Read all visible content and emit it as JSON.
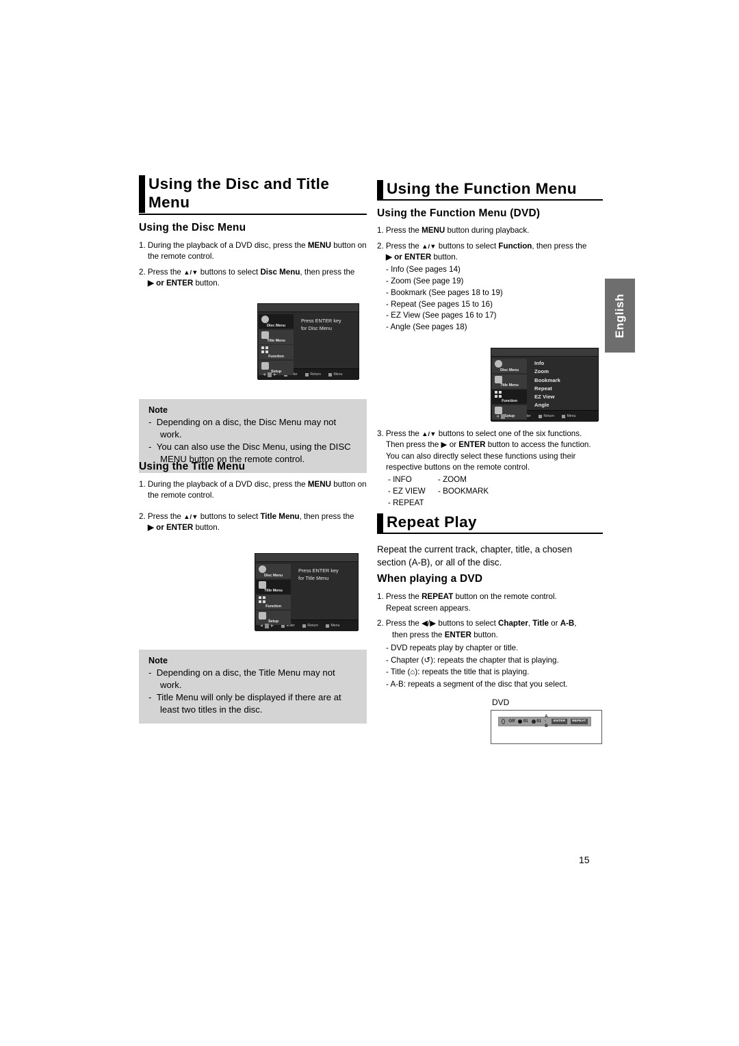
{
  "page": {
    "number": "15",
    "side_tab": "English"
  },
  "left_column": {
    "heading": "Using the Disc and Title Menu",
    "disc_menu": {
      "subheading": "Using the Disc Menu",
      "steps": [
        {
          "num": "1.",
          "parts": [
            "During the playback of a DVD disc, press the ",
            "MENU",
            " button on the remote control."
          ]
        },
        {
          "num": "2.",
          "parts": [
            "Press the ",
            "▲/▼",
            " buttons to select ",
            "Disc Menu",
            ", then press the ",
            "▶ or ENTER",
            " button."
          ]
        }
      ],
      "screen": {
        "sidebar": [
          "Disc Menu",
          "Title Menu",
          "Function",
          "Setup"
        ],
        "selected": "Disc Menu",
        "content_lines": [
          "Press ENTER key",
          "for Disc Menu"
        ],
        "bottom_keys": [
          "Enter",
          "Return",
          "Menu"
        ]
      },
      "note": {
        "title": "Note",
        "items": [
          "Depending on a disc, the Disc Menu may not work.",
          "You can also use the Disc Menu, using the DISC MENU button on the remote control."
        ]
      }
    },
    "title_menu": {
      "subheading": "Using the Title Menu",
      "steps": [
        {
          "num": "1.",
          "parts": [
            "During the playback of a DVD disc, press the ",
            "MENU",
            " button on the remote control."
          ]
        },
        {
          "num": "2.",
          "parts": [
            "Press the ",
            "▲/▼",
            " buttons to select ",
            "Title Menu",
            ", then press the ",
            "▶ or ENTER",
            " button."
          ]
        }
      ],
      "screen": {
        "sidebar": [
          "Disc Menu",
          "Title Menu",
          "Function",
          "Setup"
        ],
        "selected": "Title Menu",
        "content_lines": [
          "Press ENTER key",
          "for Title Menu"
        ],
        "bottom_keys": [
          "Enter",
          "Return",
          "Menu"
        ]
      },
      "note": {
        "title": "Note",
        "items": [
          "Depending on a disc, the Title Menu may not work.",
          "Title Menu will only be displayed if there are at least two titles in the disc."
        ]
      }
    }
  },
  "right_column": {
    "heading": "Using the Function Menu",
    "function_menu": {
      "subheading": "Using the Function Menu (DVD)",
      "step1_pre": "Press the ",
      "step1_bold": "MENU",
      "step1_post": " button during playback.",
      "step2_a": "Press the ",
      "step2_ud": "▲/▼",
      "step2_b": " buttons to select ",
      "step2_bold": "Function",
      "step2_c": ", then press the ",
      "step2_d": "▶ or ENTER",
      "step2_e": " button.",
      "function_list": [
        "- Info (See pages 14)",
        "- Zoom (See page 19)",
        "- Bookmark (See pages 18 to 19)",
        "- Repeat (See pages 15 to 16)",
        "- EZ View (See pages 16 to 17)",
        "- Angle (See pages 18)"
      ],
      "screen": {
        "sidebar": [
          "Disc Menu",
          "Title Menu",
          "Function",
          "Setup"
        ],
        "selected": "Function",
        "menu_items": [
          "Info",
          "Zoom",
          "Bookmark",
          "Repeat",
          "EZ View",
          "Angle"
        ],
        "bottom_keys": [
          "Enter",
          "Return",
          "Menu"
        ]
      },
      "step3": {
        "num": "3.",
        "l1_a": "Press the ",
        "l1_ud": "▲/▼",
        "l1_b": " buttons to select one of the six functions.",
        "l2_a": "Then press the ▶ or ",
        "l2_bold": "ENTER",
        "l2_b": " button to access the function.",
        "l3": "You can also directly select these functions using their",
        "l4": "respective buttons on the remote control."
      },
      "button_grid": [
        [
          "- INFO",
          "- ZOOM"
        ],
        [
          "- EZ VIEW",
          "- BOOKMARK"
        ],
        [
          "- REPEAT",
          ""
        ]
      ]
    },
    "repeat_play": {
      "heading": "Repeat Play",
      "intro": "Repeat the current track, chapter, title, a chosen section (A-B), or all of the disc.",
      "subheading": "When playing a DVD",
      "step1": {
        "num": "1.",
        "a": "Press the ",
        "bold": "REPEAT",
        "b": " button on the remote control.",
        "cont": "Repeat screen appears."
      },
      "step2": {
        "num": "2.",
        "a": "Press the ◀/▶ buttons to select ",
        "bold1": "Chapter",
        "b": ", ",
        "bold2": "Title",
        "c": " or ",
        "bold3": "A-B",
        "d": ",",
        "cont_a": "then press the ",
        "cont_bold": "ENTER",
        "cont_b": " button."
      },
      "details": [
        "- DVD repeats play by chapter or title.",
        "- Chapter (↺): repeats the chapter that is playing.",
        "- Title (⌂): repeats the title that is playing.",
        "- A-B: repeats a segment of the disc that you select."
      ],
      "osd": {
        "label": "DVD",
        "items": [
          "Off",
          "01",
          "01",
          "A - B"
        ],
        "buttons": [
          "ENTER",
          "REPEAT"
        ]
      }
    }
  }
}
